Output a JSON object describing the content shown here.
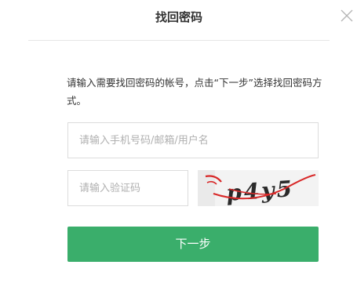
{
  "dialog": {
    "title": "找回密码",
    "close_icon": "close-icon",
    "description": "请输入需要找回密码的帐号，点击“下一步”选择找回密码方式。"
  },
  "form": {
    "account_placeholder": "请输入手机号码/邮箱/用户名",
    "account_value": "",
    "code_placeholder": "请输入验证码",
    "code_value": "",
    "captcha_text": "p4y5",
    "next_label": "下一步"
  },
  "colors": {
    "button_green": "#3aae6b",
    "captcha_red": "#d82828",
    "captcha_ink": "#2a2a2a"
  }
}
